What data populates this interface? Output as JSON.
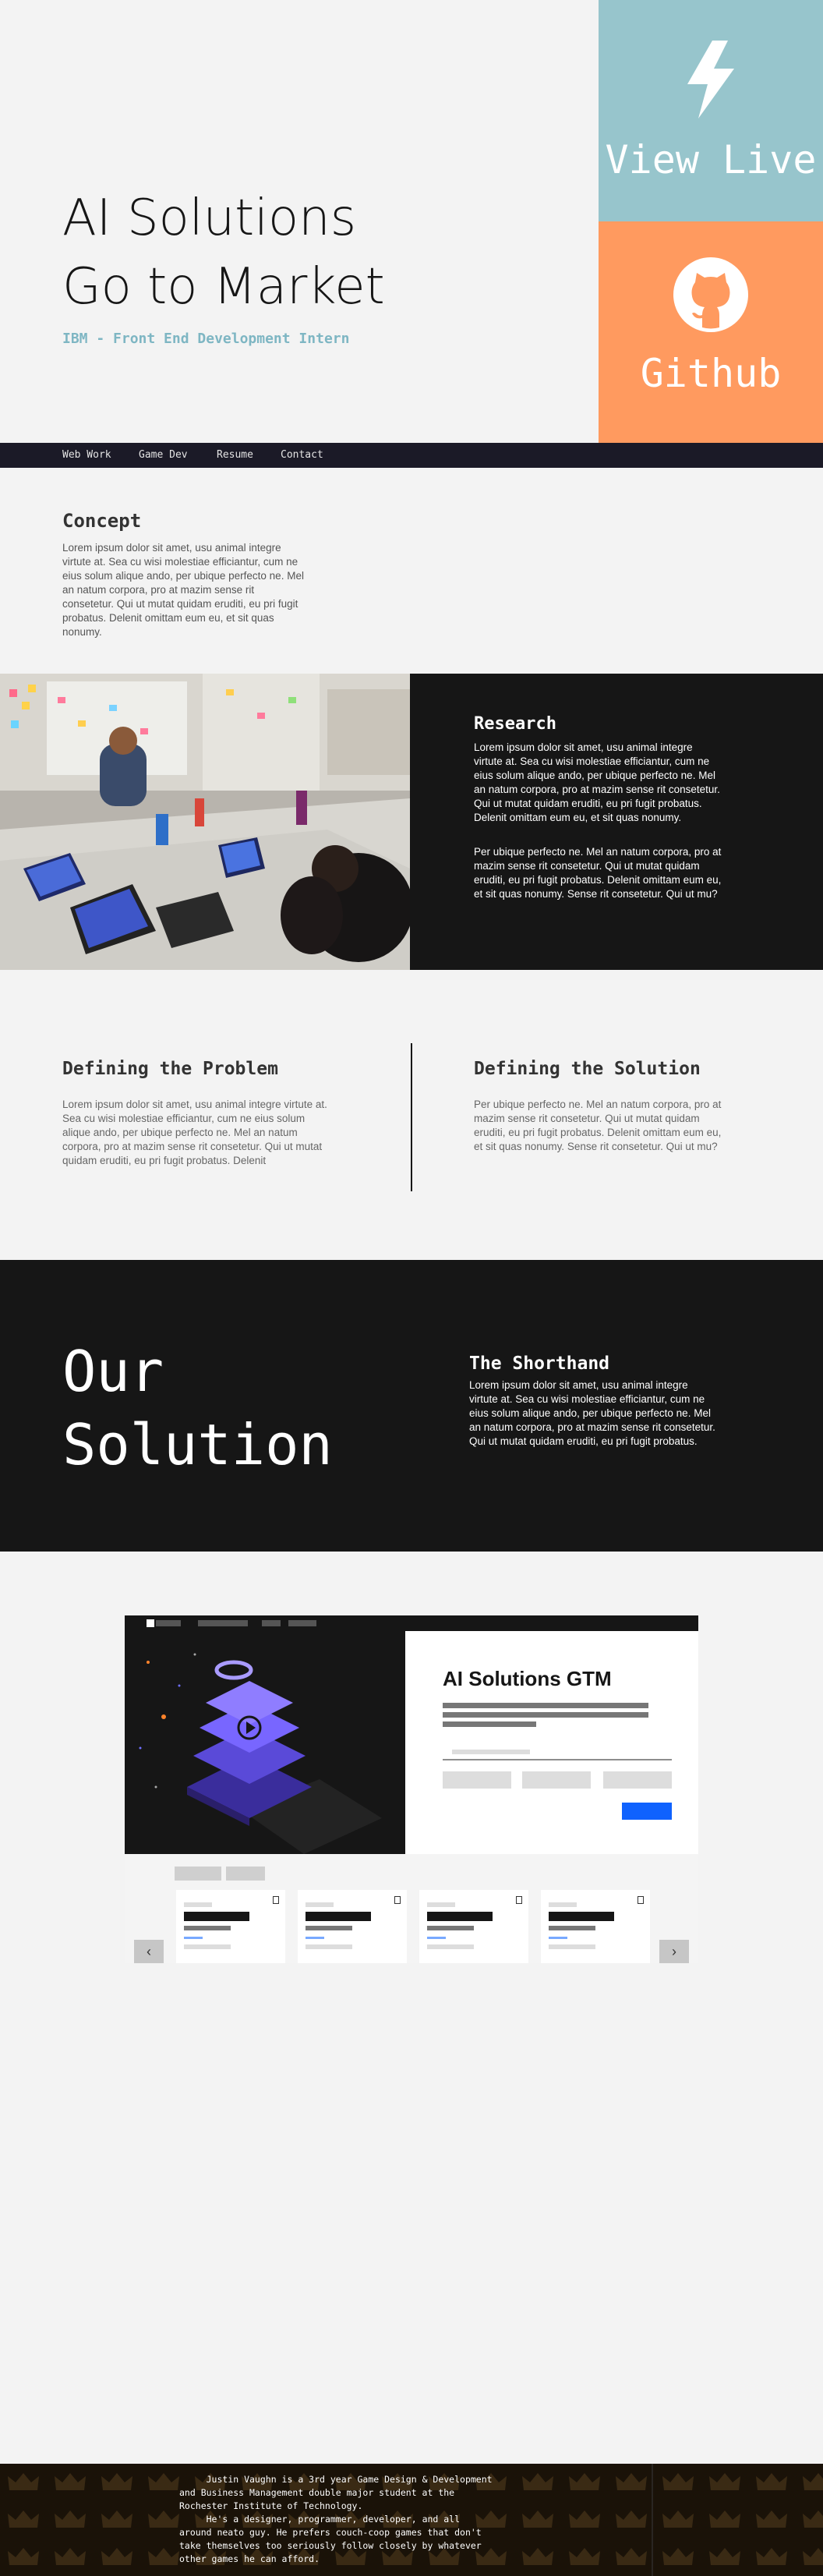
{
  "hero": {
    "title_line1": "AI Solutions",
    "title_line2": "Go to Market",
    "subtitle": "IBM - Front End Development Intern",
    "view_live_label": "View Live",
    "view_live_icon": "lightning-bolt-icon",
    "github_label": "Github",
    "github_icon": "github-icon",
    "colors": {
      "view_live_bg": "#97c5cc",
      "github_bg": "#ff9a5f",
      "subtitle": "#7eb6c3"
    }
  },
  "nav": {
    "items": [
      "Web Work",
      "Game Dev",
      "Resume",
      "Contact"
    ]
  },
  "concept": {
    "heading": "Concept",
    "body": "Lorem ipsum dolor sit amet, usu animal integre virtute at. Sea cu wisi molestiae efficiantur, cum ne eius solum alique ando, per ubique perfecto ne. Mel an natum corpora, pro at mazim sense rit consetetur. Qui ut mutat quidam eruditi, eu pri fugit probatus. Delenit omittam eum eu, et sit quas nonumy."
  },
  "research": {
    "heading": "Research",
    "body1": "Lorem ipsum dolor sit amet, usu animal integre virtute at. Sea cu wisi molestiae efficiantur, cum ne eius solum alique ando, per ubique perfecto ne. Mel an natum corpora, pro at mazim sense rit consetetur. Qui ut mutat quidam eruditi, eu pri fugit probatus. Delenit omittam eum eu, et sit quas nonumy.",
    "body2": "Per ubique perfecto ne. Mel an natum corpora, pro at mazim sense rit consetetur. Qui ut mutat quidam eruditi, eu pri fugit probatus. Delenit omittam eum eu, et sit quas nonumy. Sense rit consetetur. Qui ut mu?"
  },
  "problem": {
    "heading": "Defining the Problem",
    "body": "Lorem ipsum dolor sit amet, usu animal integre virtute at. Sea cu wisi molestiae efficiantur, cum ne eius solum alique ando, per ubique perfecto ne. Mel an natum corpora, pro at mazim sense rit consetetur. Qui ut mutat quidam eruditi, eu pri fugit probatus. Delenit"
  },
  "solution": {
    "heading": "Defining the Solution",
    "body": "Per ubique perfecto ne. Mel an natum corpora, pro at mazim sense rit consetetur. Qui ut mutat quidam eruditi, eu pri fugit probatus. Delenit omittam eum eu, et sit quas nonumy. Sense rit consetetur. Qui ut mu?"
  },
  "our_solution": {
    "title_line1": "Our",
    "title_line2": "Solution",
    "shorthand_heading": "The Shorthand",
    "shorthand_body": "Lorem ipsum dolor sit amet, usu animal integre virtute at. Sea cu wisi molestiae efficiantur, cum ne eius solum alique ando, per ubique perfecto ne. Mel an natum corpora, pro at mazim sense rit consetetur. Qui ut mutat quidam eruditi, eu pri fugit probatus."
  },
  "mockup": {
    "title": "AI Solutions GTM",
    "prev_icon": "chevron-left-icon",
    "next_icon": "chevron-right-icon",
    "prev_label": "‹",
    "next_label": "›",
    "accent": "#0f62fe"
  },
  "footer": {
    "bio": "     Justin Vaughn is a 3rd year Game Design & Development\nand Business Management double major student at the\nRochester Institute of Technology.\n     He's a designer, programmer, developer, and all\naround neato guy. He prefers couch-coop games that don't\ntake themselves too seriously follow closely by whatever\nother games he can afford."
  }
}
